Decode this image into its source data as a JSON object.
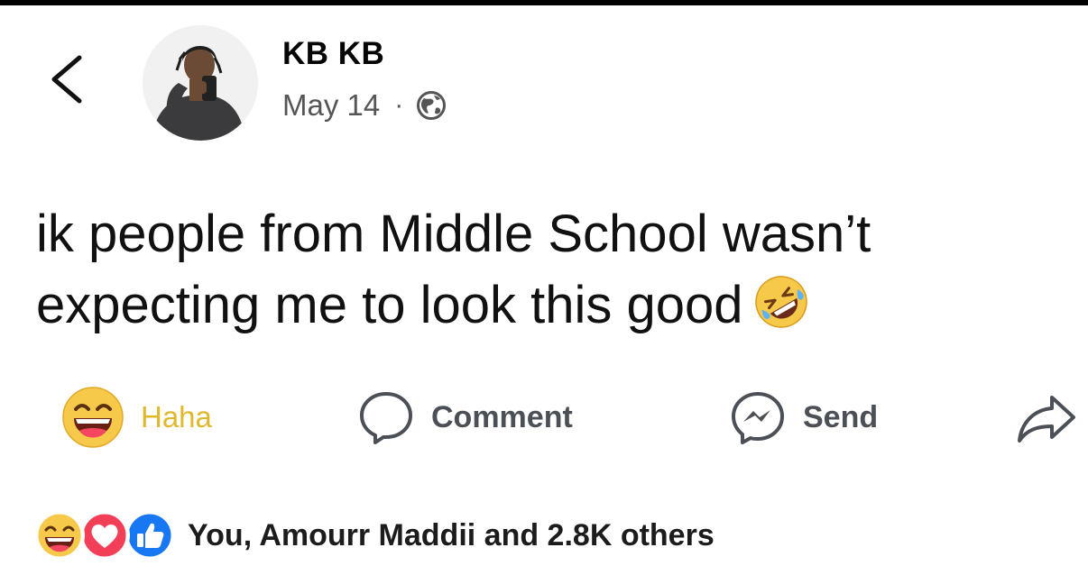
{
  "post": {
    "author": "KB KB",
    "date": "May 14",
    "separator": "·",
    "audience_icon": "globe-icon",
    "text_lines": [
      "ik people from Middle School wasn’t",
      "expecting me to look this good"
    ],
    "trailing_emoji": "rolling-on-floor-laughing-emoji"
  },
  "actions": {
    "haha_label": "Haha",
    "comment_label": "Comment",
    "send_label": "Send",
    "share_icon": "share-arrow-icon"
  },
  "reactions": {
    "icons": [
      "haha",
      "love",
      "like"
    ],
    "summary": "You, Amourr Maddii and 2.8K others"
  },
  "colors": {
    "haha_yellow": "#f7c94a",
    "haha_label": "#e0b82e",
    "love_red": "#f33e58",
    "like_blue": "#1877f2",
    "action_gray": "#4b4f56"
  }
}
